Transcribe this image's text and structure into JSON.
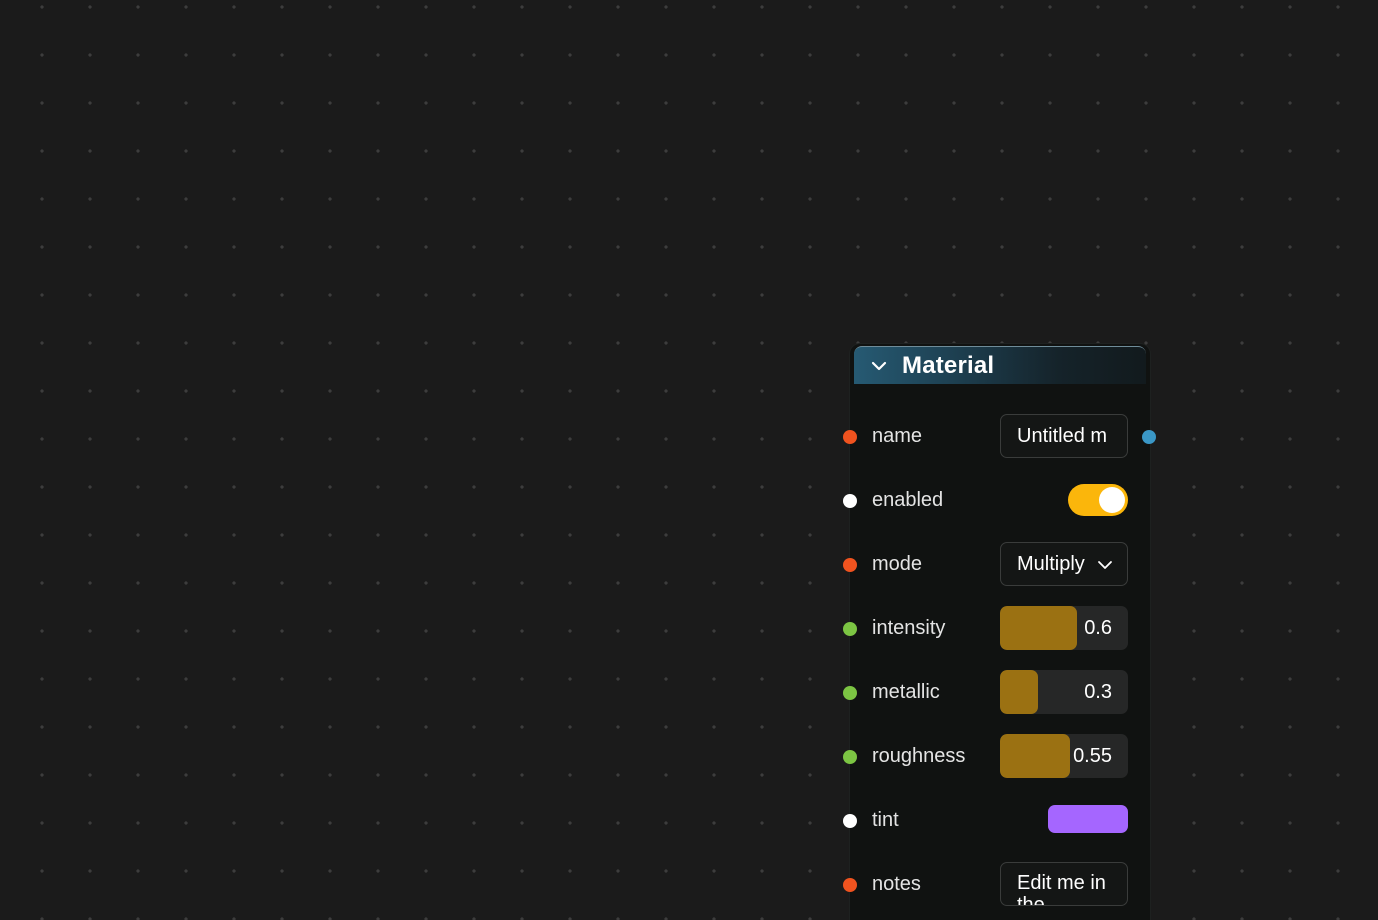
{
  "colors": {
    "port_string": "#f0531f",
    "port_bool": "#ffffff",
    "port_number": "#7cc543",
    "port_output": "#3a97c6",
    "toggle_on": "#fbb60b",
    "slider_fill": "#9b7112"
  },
  "node": {
    "title": "Material",
    "collapse_icon": "chevron-down-icon",
    "fields": {
      "name": {
        "label": "name",
        "value": "Untitled m"
      },
      "enabled": {
        "label": "enabled",
        "value": true
      },
      "mode": {
        "label": "mode",
        "value": "Multiply",
        "icon": "chevron-down-icon"
      },
      "intensity": {
        "label": "intensity",
        "value": 0.6,
        "display": "0.6"
      },
      "metallic": {
        "label": "metallic",
        "value": 0.3,
        "display": "0.3"
      },
      "roughness": {
        "label": "roughness",
        "value": 0.55,
        "display": "0.55"
      },
      "tint": {
        "label": "tint",
        "value": "#a566ff"
      },
      "notes": {
        "label": "notes",
        "value": "Edit me in the"
      }
    }
  }
}
